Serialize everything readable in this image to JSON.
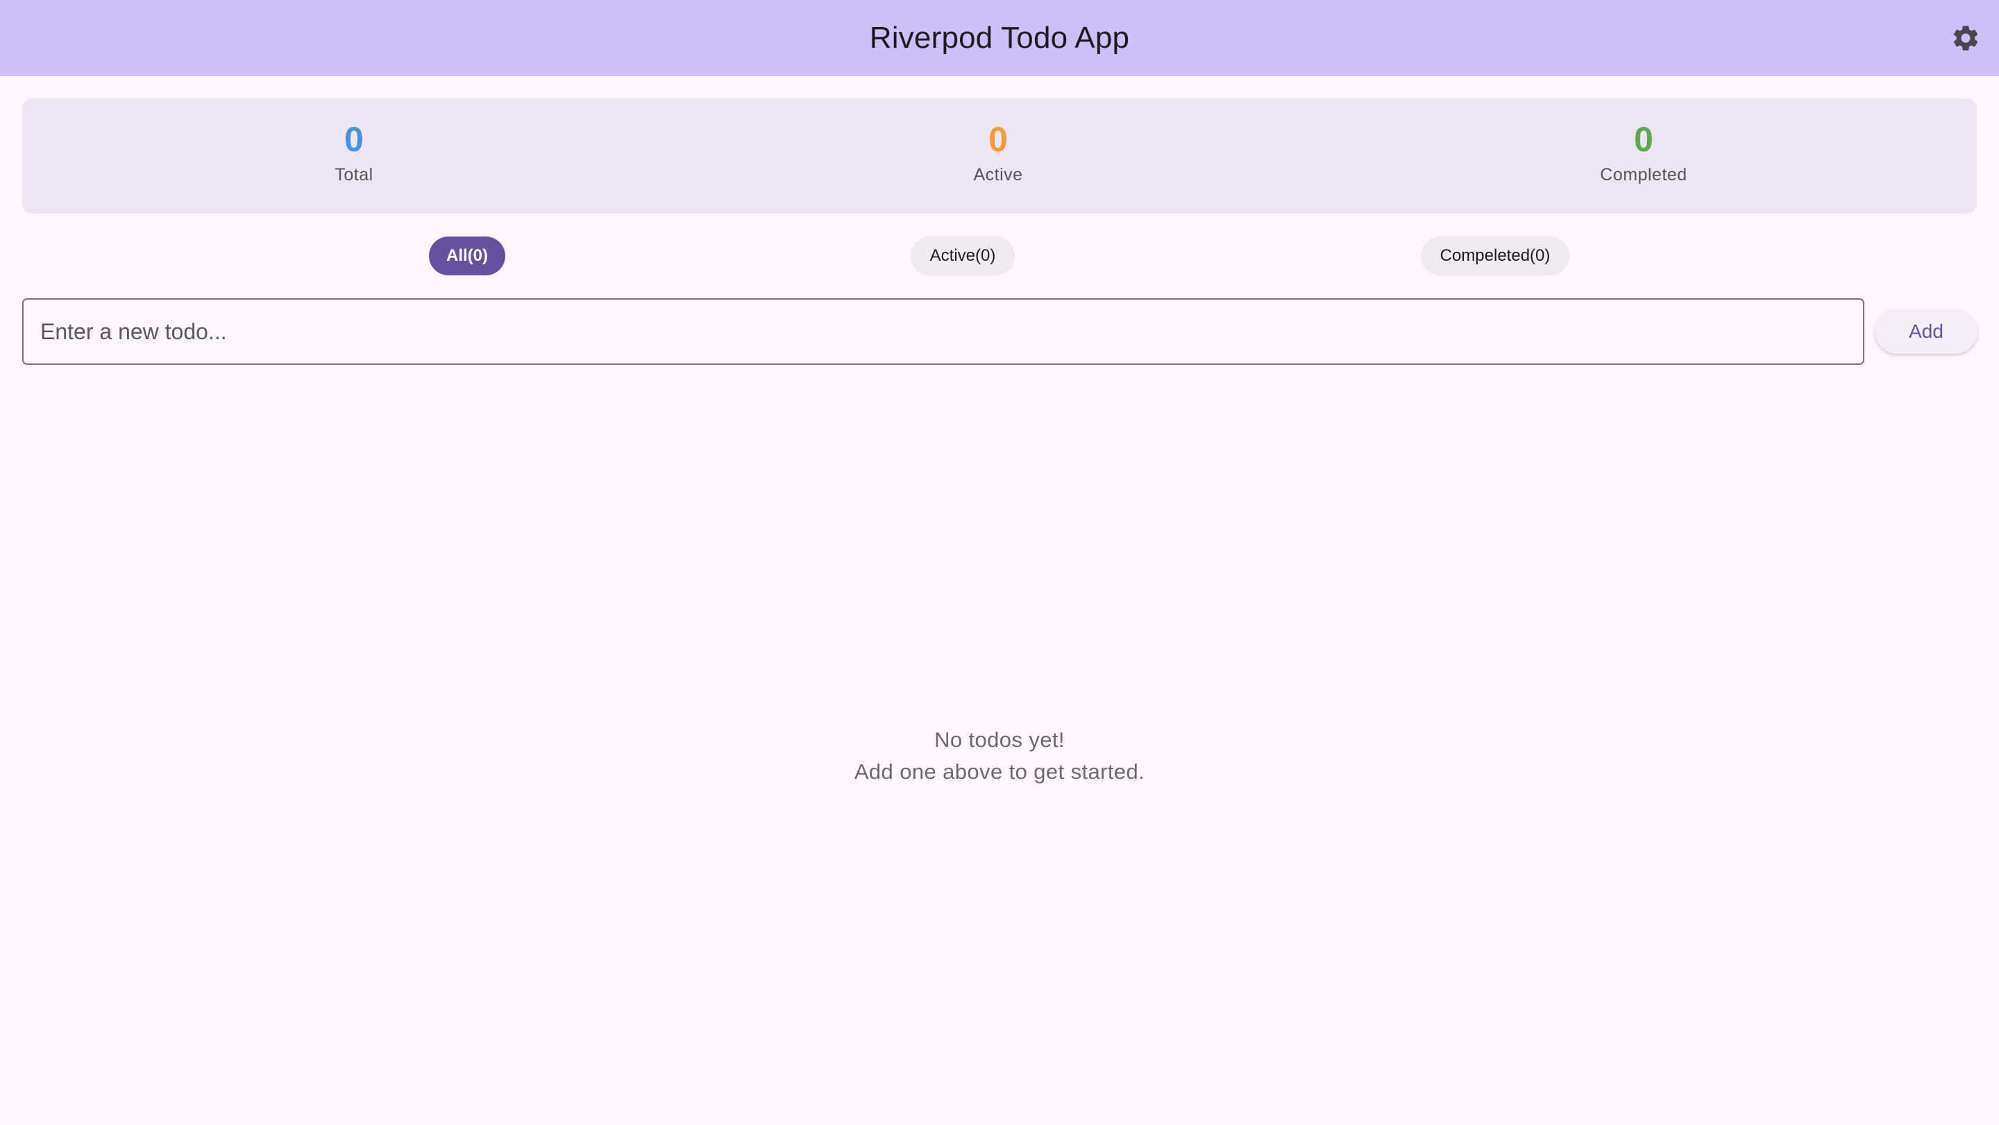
{
  "app": {
    "title": "Riverpod Todo App",
    "settings_icon": "gear-icon"
  },
  "colors": {
    "appbar": "#cdbff7",
    "primary": "#65529e",
    "total": "#4a90e2",
    "active": "#f39a36",
    "completed": "#5fa84f"
  },
  "stats": {
    "total": {
      "value": "0",
      "label": "Total"
    },
    "active": {
      "value": "0",
      "label": "Active"
    },
    "completed": {
      "value": "0",
      "label": "Completed"
    }
  },
  "filters": {
    "selected": "all",
    "all": "All(0)",
    "active": "Active(0)",
    "completed": "Compeleted(0)"
  },
  "input": {
    "placeholder": "Enter a new todo...",
    "value": ""
  },
  "add_button": "Add",
  "empty": {
    "line1": "No todos yet!",
    "line2": "Add one above to get started."
  }
}
